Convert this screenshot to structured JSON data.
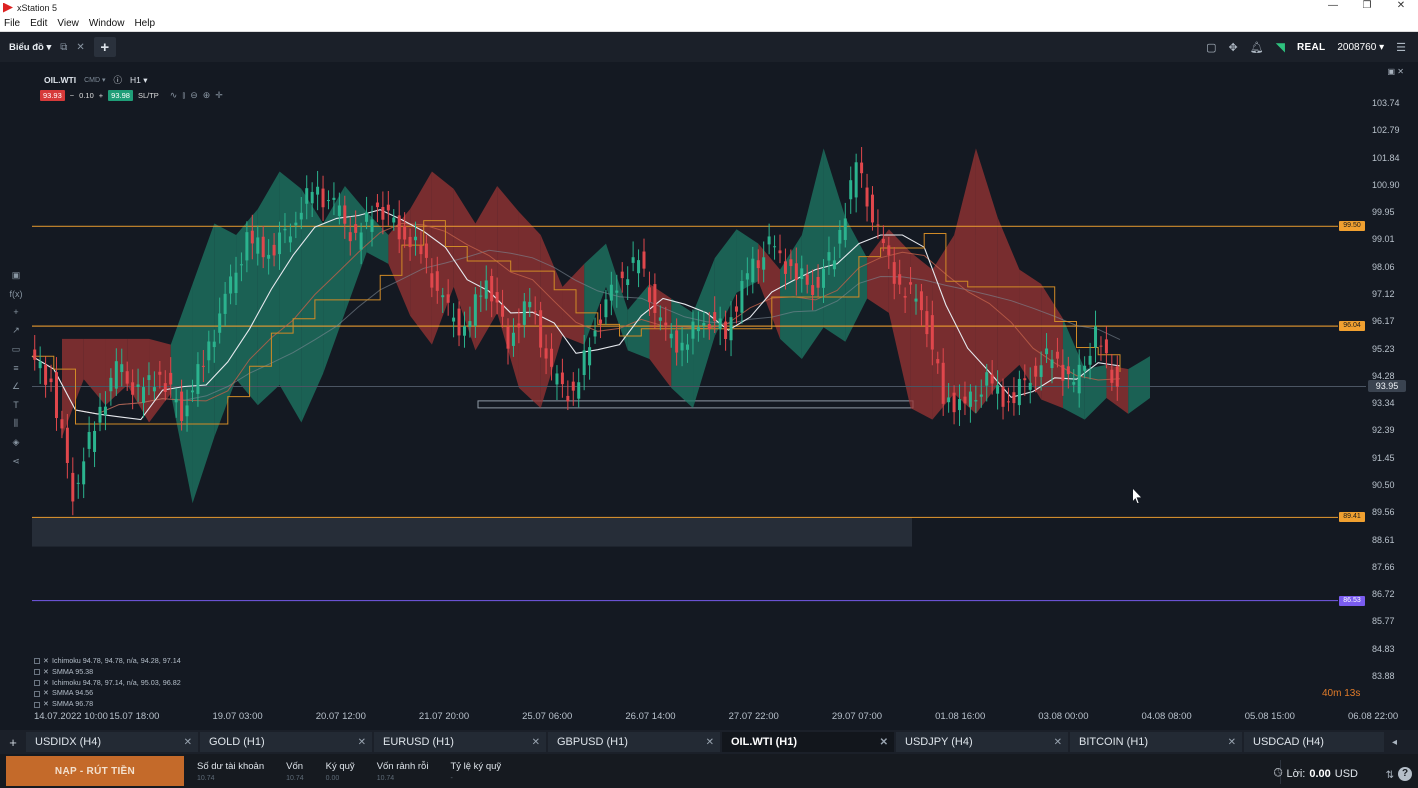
{
  "window": {
    "title": "xStation 5",
    "controls": [
      "—",
      "❐",
      "✕"
    ]
  },
  "menu": [
    "File",
    "Edit",
    "View",
    "Window",
    "Help"
  ],
  "toolbar": {
    "tab_label": "Biểu đồ",
    "account_type": "REAL",
    "account_number": "2008760"
  },
  "chart": {
    "symbol": "OIL.WTI",
    "symbol_sub": "CMD",
    "timeframe": "H1",
    "sell_price": "93.93",
    "volume": "0.10",
    "buy_price": "93.98",
    "sltp_label": "SL/TP",
    "timer": "40m 13s",
    "legend": [
      "Ichimoku 94.78, 94.78, n/a, 94.28, 97.14",
      "SMMA 95.38",
      "Ichimoku 94.78, 97.14, n/a, 95.03, 96.82",
      "SMMA 94.56",
      "SMMA 96.78"
    ],
    "current_price_tag": "93.95",
    "price_tags": [
      {
        "label": "99.50",
        "color": "#f0a030"
      },
      {
        "label": "96.04",
        "color": "#f0a030"
      },
      {
        "label": "89.41",
        "color": "#f0a030"
      },
      {
        "label": "86.53",
        "color": "#7a5cf0"
      }
    ]
  },
  "chart_data": {
    "type": "line",
    "title": "OIL.WTI H1",
    "y_ticks": [
      "103.74",
      "102.79",
      "101.84",
      "100.90",
      "99.95",
      "99.01",
      "98.06",
      "97.12",
      "96.17",
      "95.23",
      "94.28",
      "93.34",
      "92.39",
      "91.45",
      "90.50",
      "89.56",
      "88.61",
      "87.66",
      "86.72",
      "85.77",
      "84.83",
      "83.88"
    ],
    "x_ticks": [
      "14.07.2022 10:00",
      "15.07 18:00",
      "19.07 03:00",
      "20.07 12:00",
      "21.07 20:00",
      "25.07 06:00",
      "26.07 14:00",
      "27.07 22:00",
      "29.07 07:00",
      "01.08 16:00",
      "03.08 00:00",
      "04.08 08:00",
      "05.08 15:00",
      "06.08 22:00"
    ],
    "ylim": [
      83.88,
      103.74
    ],
    "horizontal_levels": [
      99.5,
      96.04,
      89.41,
      86.53
    ],
    "series": [
      {
        "name": "OIL.WTI",
        "values": [
          95.0,
          94.1,
          90.3,
          92.6,
          94.6,
          93.7,
          94.4,
          93.1,
          94.8,
          96.9,
          99.0,
          98.6,
          99.5,
          100.8,
          100.2,
          99.0,
          100.3,
          99.4,
          98.6,
          96.8,
          95.8,
          97.8,
          95.6,
          96.9,
          94.3,
          93.6,
          96.1,
          97.6,
          98.3,
          96.0,
          95.3,
          96.4,
          95.9,
          97.8,
          98.8,
          98.0,
          97.4,
          98.6,
          101.6,
          99.2,
          97.4,
          96.9,
          93.6,
          93.2,
          94.1,
          93.4,
          94.4,
          95.1,
          93.9,
          95.7,
          93.95
        ]
      }
    ]
  },
  "tabs": [
    {
      "label": "USDIDX (H4)",
      "active": false
    },
    {
      "label": "GOLD (H1)",
      "active": false
    },
    {
      "label": "EURUSD (H1)",
      "active": false
    },
    {
      "label": "GBPUSD (H1)",
      "active": false
    },
    {
      "label": "OIL.WTI (H1)",
      "active": true
    },
    {
      "label": "USDJPY (H4)",
      "active": false
    },
    {
      "label": "BITCOIN (H1)",
      "active": false
    },
    {
      "label": "USDCAD (H4)",
      "active": false
    }
  ],
  "bottom": {
    "deposit_label": "NẠP - RÚT TIỀN",
    "stats": [
      {
        "label": "Số dư tài khoản",
        "value": "10.74"
      },
      {
        "label": "Vốn",
        "value": "10.74"
      },
      {
        "label": "Ký quỹ",
        "value": "0.00"
      },
      {
        "label": "Vốn rảnh rỗi",
        "value": "10.74"
      },
      {
        "label": "Tỷ lệ ký quỹ",
        "value": "-"
      }
    ],
    "profit_label": "Lời:",
    "profit_value": "0.00",
    "currency": "USD"
  }
}
